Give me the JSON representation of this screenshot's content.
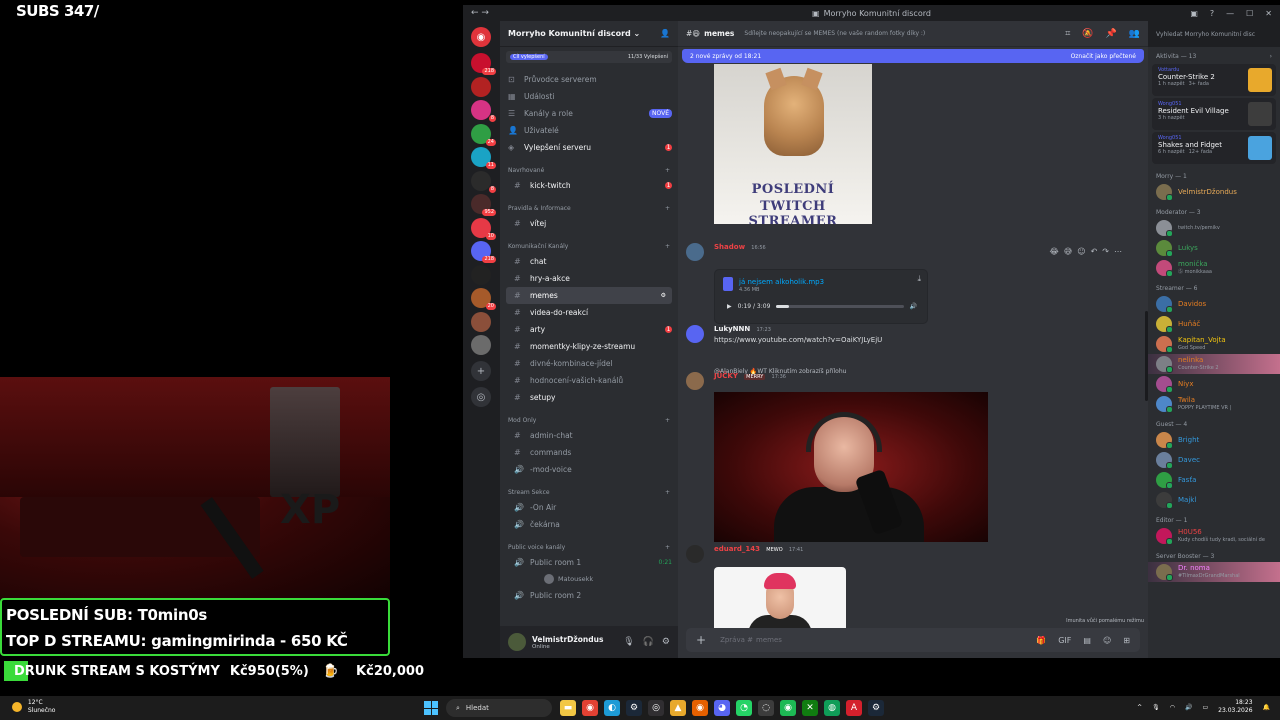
{
  "overlay": {
    "subs": "SUBS 347/",
    "last_sub": "POSLEDNÍ SUB: T0min0s",
    "top_donor": "TOP D STREAMU: gamingmirinda - 650 KČ",
    "goal_title": "DRUNK STREAM S KOSTÝMY",
    "goal_amount": "Kč950(5%)",
    "goal_target": "Kč20,000",
    "goal_progress_percent": 5
  },
  "window": {
    "title": "Morryho Komunitní discord"
  },
  "guild_badges": [
    "218",
    "",
    "8",
    "24",
    "11",
    "8",
    "952",
    "10",
    "218",
    "",
    "20",
    "",
    ""
  ],
  "server": {
    "name": "Morryho Komunitní discord",
    "boost_label": "Cíl vylepšení",
    "boost_progress": "11/33 Vylepšení",
    "nav": [
      {
        "label": "Průvodce serverem"
      },
      {
        "label": "Události"
      },
      {
        "label": "Kanály a role",
        "tag": "NOVÉ"
      },
      {
        "label": "Uživatelé"
      },
      {
        "label": "Vylepšení serveru",
        "badge": "1"
      }
    ],
    "categories": [
      {
        "name": "Navrhované",
        "channels": [
          {
            "name": "kick-twitch",
            "badge": "1",
            "unread": true
          }
        ]
      },
      {
        "name": "Pravidla & Informace",
        "channels": [
          {
            "name": "vítej",
            "unread": true
          }
        ]
      },
      {
        "name": "Komunikační Kanály",
        "channels": [
          {
            "name": "chat",
            "unread": true
          },
          {
            "name": "hry-a-akce",
            "unread": true
          },
          {
            "name": "memes",
            "selected": true
          },
          {
            "name": "videa-do-reakcí",
            "unread": true
          },
          {
            "name": "arty",
            "badge": "1",
            "unread": true
          },
          {
            "name": "momentky-klipy-ze-streamu",
            "unread": true
          },
          {
            "name": "divné-kombinace-jídel"
          },
          {
            "name": "hodnocení-vašich-kanálů"
          },
          {
            "name": "setupy",
            "unread": true
          }
        ]
      },
      {
        "name": "Mod Only",
        "channels": [
          {
            "name": "admin-chat"
          },
          {
            "name": "commands"
          },
          {
            "name": "-mod-voice"
          }
        ]
      },
      {
        "name": "Stream Sekce",
        "channels": [
          {
            "name": "-On Air"
          },
          {
            "name": "čekárna"
          }
        ]
      },
      {
        "name": "Public voice kanály",
        "channels": [
          {
            "name": "Public room 1",
            "time": "0:21"
          },
          {
            "name": "Public room 2"
          }
        ]
      }
    ],
    "voice_user": "Matousekk"
  },
  "user": {
    "name": "VelmistrDžondus",
    "status": "Online"
  },
  "chat": {
    "channel": "memes",
    "topic": "Sdílejte neopakující se MEMES (ne vaše random fotky díky :)",
    "new_messages": "2 nové zprávy od 18:21",
    "mark_read": "Označit jako přečtené",
    "cat_caption_1": "POSLEDNÍ",
    "cat_caption_2": "TWITCH STREAMER",
    "audio_author": "Shadow",
    "audio_time": "16:56",
    "audio_file": "já nejsem alkoholik.mp3",
    "audio_size": "4.36 MB",
    "audio_progress": "0:19 / 3:09",
    "audio_progress_fraction": 0.1,
    "msg2_author": "LukyNNN",
    "msg2_time": "17:23",
    "msg2_link": "https://www.youtube.com/watch?v=OaiKYJLyEjU",
    "reply_text": "@AlanBiely 🔥WT Kliknutím zobrazíš přílohu",
    "msg3_author": "JÜČKY",
    "msg3_tag": "MERRY",
    "msg3_time": "17:36",
    "msg4_author": "eduard_143",
    "msg4_tag": "MEWO",
    "msg4_time": "17:41",
    "typing": "Imunita vůči pomalému režimu",
    "composer_placeholder": "Zpráva #",
    "composer_channel": "memes"
  },
  "members": {
    "search_placeholder": "Vyhledat Morryho Komunitní disc",
    "activity_header": "Aktivita — 13",
    "activities": [
      {
        "user": "Vottardu",
        "game": "Counter-Strike 2",
        "time": "1 h nazpět",
        "extra": "3+ řada"
      },
      {
        "user": "Wong051",
        "game": "Resident Evil Village",
        "time": "3 h nazpět",
        "extra": ""
      },
      {
        "user": "Wong051",
        "game": "Shakes and Fidget",
        "time": "6 h nazpět",
        "extra": "12+ řada"
      }
    ],
    "roles": [
      {
        "name": "Morry — 1",
        "members": [
          {
            "name": "VelmistrDžondus",
            "color": "#e6a957"
          }
        ]
      },
      {
        "name": "Moderator — 3",
        "members": [
          {
            "name": "",
            "sub": "twitch.tv/pemikv",
            "color": "#3ba55c"
          },
          {
            "name": "Lukys",
            "color": "#3ba55c"
          },
          {
            "name": "monička",
            "sub": "Ⓢ monikkaaa",
            "color": "#3ba55c"
          }
        ]
      },
      {
        "name": "Streamer — 6",
        "members": [
          {
            "name": "Davidos",
            "color": "#e67e22"
          },
          {
            "name": "Huňáč",
            "color": "#e67e22"
          },
          {
            "name": "Kapitan_Vojta",
            "sub": "God Speed",
            "color": "#f1c40f"
          },
          {
            "name": "nelinka",
            "sub": "Counter-Strike 2",
            "color": "#e67e22",
            "highlight": true
          },
          {
            "name": "Niyx",
            "color": "#e67e22"
          },
          {
            "name": "Twila",
            "sub": "POPPY PLAYTIME VR |",
            "color": "#e67e22"
          }
        ]
      },
      {
        "name": "Guest — 4",
        "members": [
          {
            "name": "Bright",
            "color": "#3498db"
          },
          {
            "name": "Davec",
            "color": "#3498db"
          },
          {
            "name": "Fasťa",
            "color": "#3498db"
          },
          {
            "name": "Majkl",
            "color": "#3498db"
          }
        ]
      },
      {
        "name": "Editor — 1",
        "members": [
          {
            "name": "H0U56",
            "sub": "Kudy chodíš tudy kradi, sociální de",
            "color": "#ed4245"
          }
        ]
      },
      {
        "name": "Server Booster — 3",
        "members": [
          {
            "name": "Dr. noma",
            "sub": "#TilmaxDrGrandMarshal",
            "color": "#f47fff",
            "highlight": true
          }
        ]
      }
    ]
  },
  "taskbar": {
    "temp": "12°C",
    "weather": "Slunečno",
    "search": "Hledat",
    "time": "18:23",
    "date": "23.03.2026"
  }
}
